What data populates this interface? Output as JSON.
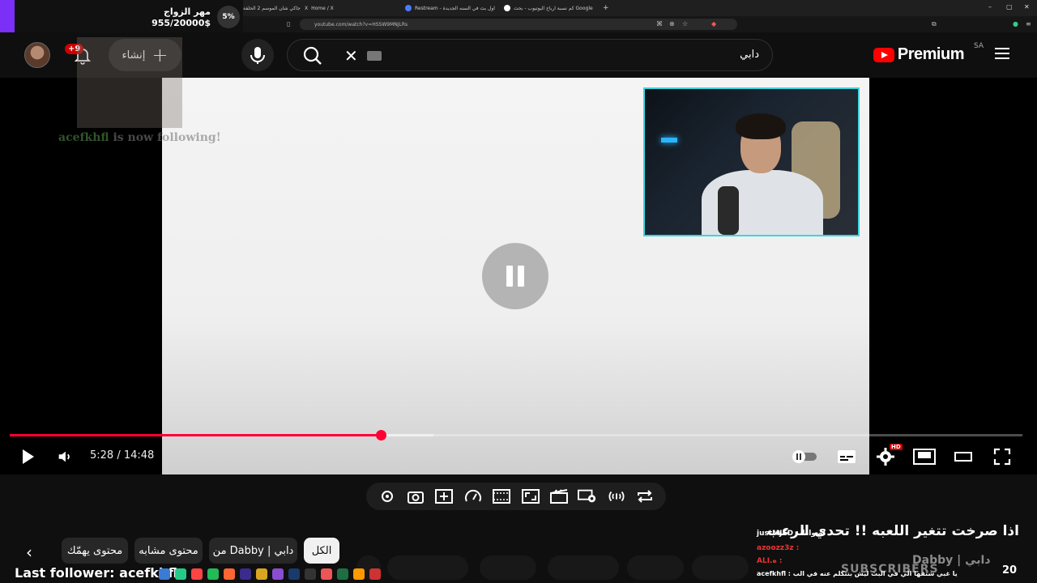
{
  "browser": {
    "tabs": [
      {
        "label": "جاكي شان الموسم 2 الحلقة"
      },
      {
        "label": "Home / X"
      },
      {
        "label": "Restream - اول بث في السنه الجديدة"
      },
      {
        "label": "كم نسبة ارباح اليوتيوب - بحث Google"
      }
    ],
    "new_tab": "+",
    "url": "youtube.com/watch?v=HSSW9MNJLRs",
    "win_min": "–",
    "win_max": "▢",
    "win_close": "✕"
  },
  "donation_goal": {
    "title": "مهر الزواج",
    "amount": "955/20000$",
    "percent": "5%",
    "accent": "#7b2ff7"
  },
  "header": {
    "logo": "Premium",
    "region": "SA",
    "search_query": "دابي",
    "create_label": "إنشاء",
    "notification_badge": "+9"
  },
  "follower_alert": {
    "name": "acefkhfl",
    "text": "is now following!"
  },
  "player": {
    "current_time": "5:28",
    "duration": "14:48",
    "time_display": "5:28 / 14:48",
    "played_fraction": 0.366,
    "buffered_fraction": 0.418,
    "hd_badge": "HD",
    "progress_color": "#ff0033"
  },
  "chips": {
    "all": "الكل",
    "from_dabby": "من Dabby | دابي",
    "similar": "محتوى مشابه",
    "interests": "محتوى يهمّك"
  },
  "chat": {
    "title": "اذا صرخت تتغير اللعبه !! تحدي الرعب",
    "line1": "justMJED : اصواط",
    "line2": "azoozz3z :",
    "line3": "ALI.ه :",
    "line4": "acefkhfl : يا غبي شتفها الي في البث ليش بتتكلم عنه في الب"
  },
  "channel_name": "Dabby | دابي",
  "subscribers_label": "SUBSCRIBERS",
  "subscribers_count": "20",
  "last_follower": "Last follower: acefkhfl"
}
